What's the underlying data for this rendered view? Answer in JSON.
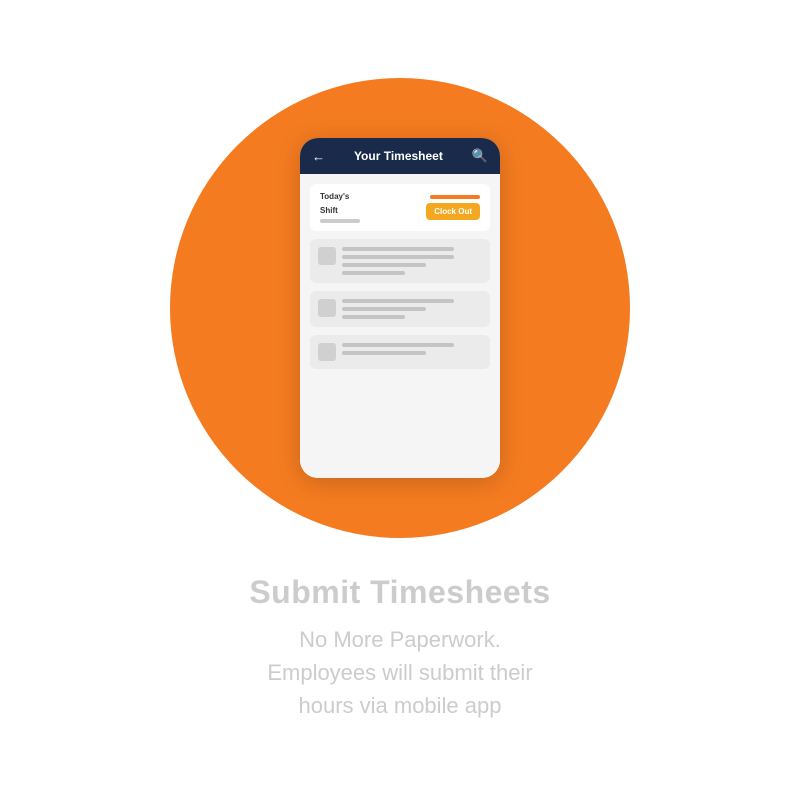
{
  "page": {
    "background": "#ffffff"
  },
  "circle": {
    "color": "#F47B20"
  },
  "phone": {
    "header": {
      "back_icon": "←",
      "title": "Your Timesheet",
      "search_icon": "🔍"
    },
    "shift": {
      "label_line1": "Today's",
      "label_line2": "Shift"
    },
    "clock_out_button": {
      "label": "Clock Out"
    },
    "cards": [
      {
        "lines": [
          "long",
          "medium",
          "short"
        ]
      },
      {
        "lines": [
          "long",
          "medium",
          "short"
        ]
      },
      {
        "lines": [
          "long",
          "medium"
        ]
      }
    ]
  },
  "text_section": {
    "title": "Submit Timesheets",
    "description_line1": "No More Paperwork.",
    "description_line2": "Employees will submit their",
    "description_line3": "hours via mobile app"
  }
}
